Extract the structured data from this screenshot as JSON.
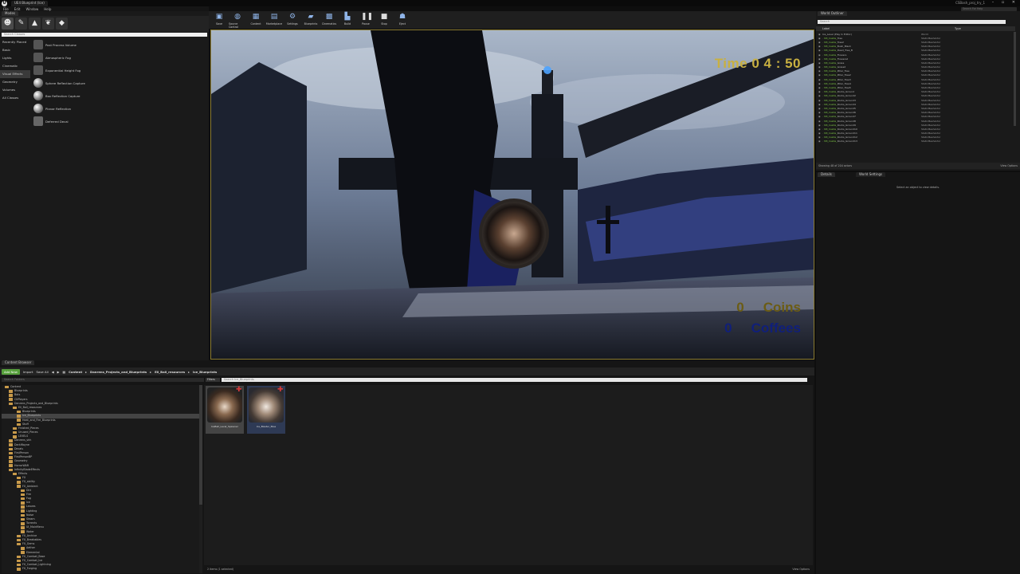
{
  "window": {
    "title": "UE4 Blueprint (Ice)",
    "project": "CSBash_proj_try_1"
  },
  "menu": [
    "File",
    "Edit",
    "Window",
    "Help"
  ],
  "modes": {
    "tab": "Modes",
    "search_placeholder": "Search Classes",
    "categories": [
      "Recently Placed",
      "Basic",
      "Lights",
      "Cinematic",
      "Visual Effects",
      "Geometry",
      "Volumes",
      "All Classes"
    ],
    "active_category": "Visual Effects",
    "items": [
      "Post Process Volume",
      "Atmospheric Fog",
      "Exponential Height Fog",
      "Sphere Reflection Capture",
      "Box Reflection Capture",
      "Planar Reflection",
      "Deferred Decal"
    ]
  },
  "toolbar": [
    "Save",
    "Source Control",
    "Content",
    "Marketplace",
    "Settings",
    "Blueprints",
    "Cinematics",
    "Build",
    "Pause",
    "Stop",
    "Eject"
  ],
  "hud": {
    "time_label": "Time",
    "time_value": "0 4 : 50",
    "coins_count": "0",
    "coins_label": "Coins",
    "coffees_count": "0",
    "coffees_label": "Coffees"
  },
  "outliner": {
    "tab": "World Outliner",
    "search_placeholder": "Search",
    "col_label": "Label",
    "col_type": "Type",
    "root": "Ice_Level (Play In Editor)",
    "root_type": "World",
    "prefix": "SM_Castle_",
    "rows": [
      "Tree",
      "Tree2",
      "Bush_Black",
      "Dead_Tree_B",
      "Flowers",
      "Flowers2",
      "Grass",
      "Grass2",
      "Pillar_Tree",
      "Pillar_Tree2",
      "Pillar_Tree3",
      "Pillar_Tree4",
      "Pillar_Tree5",
      "Rocks_Ground",
      "Rocks_Ground2",
      "Rocks_Ground3",
      "Rocks_Ground4",
      "Rocks_Ground5",
      "Rocks_Ground6",
      "Rocks_Ground7",
      "Rocks_Ground8",
      "Rocks_Ground9",
      "Rocks_Ground10",
      "Rocks_Ground11",
      "Rocks_Ground12",
      "Rocks_Ground13"
    ],
    "row_type": "StaticMeshActor",
    "status": "Showing 48 of 204 actors",
    "view_options": "View Options"
  },
  "details": {
    "tab1": "Details",
    "tab2": "World Settings",
    "empty": "Select an object to view details."
  },
  "content_browser": {
    "tab": "Content Browser",
    "add_new": "Add New",
    "import": "Import",
    "save_all": "Save All",
    "path": [
      "Content",
      "Danrens_Projects_and_Blueprints",
      "Eli_Ball_resources",
      "Ice_Blueprints"
    ],
    "search_folders": "Search Folders",
    "filters": "Filters",
    "search_assets": "Search Ice_Blueprints",
    "tree": [
      {
        "label": "Content",
        "depth": 0
      },
      {
        "label": "Blueprints",
        "depth": 1
      },
      {
        "label": "Bots",
        "depth": 1
      },
      {
        "label": "CitPlayers",
        "depth": 1
      },
      {
        "label": "Danrens_Projects_and_Blueprints",
        "depth": 1
      },
      {
        "label": "Eli_Ball_resources",
        "depth": 2
      },
      {
        "label": "Blueprints",
        "depth": 3
      },
      {
        "label": "Ice_Blueprints",
        "depth": 3,
        "selected": true
      },
      {
        "label": "Heat_and_Fire_Blueprints",
        "depth": 3
      },
      {
        "label": "Stuff",
        "depth": 3
      },
      {
        "label": "Finished_Pieces",
        "depth": 2
      },
      {
        "label": "Unused_Pieces",
        "depth": 2
      },
      {
        "label": "LEVELS",
        "depth": 2
      },
      {
        "label": "Danrens_shh",
        "depth": 1
      },
      {
        "label": "DarkWayne",
        "depth": 1
      },
      {
        "label": "Decals",
        "depth": 1
      },
      {
        "label": "FirstPerson",
        "depth": 1
      },
      {
        "label": "FirstPersonBP",
        "depth": 1
      },
      {
        "label": "Geometry",
        "depth": 1
      },
      {
        "label": "HorrorWAR",
        "depth": 1
      },
      {
        "label": "InfinityBladeEffects",
        "depth": 1
      },
      {
        "label": "Effects",
        "depth": 2
      },
      {
        "label": "FX",
        "depth": 3
      },
      {
        "label": "FX_ability",
        "depth": 3
      },
      {
        "label": "FX_Ambient",
        "depth": 3
      },
      {
        "label": "Dirt",
        "depth": 4
      },
      {
        "label": "Fire",
        "depth": 4
      },
      {
        "label": "Fog",
        "depth": 4
      },
      {
        "label": "Ice",
        "depth": 4
      },
      {
        "label": "Leaves",
        "depth": 4
      },
      {
        "label": "Lighting",
        "depth": 4
      },
      {
        "label": "Noise",
        "depth": 4
      },
      {
        "label": "Steam",
        "depth": 4
      },
      {
        "label": "Torrents",
        "depth": 4
      },
      {
        "label": "UI_MainMenu",
        "depth": 4
      },
      {
        "label": "Water",
        "depth": 4
      },
      {
        "label": "FX_Archive",
        "depth": 3
      },
      {
        "label": "FX_Breakables",
        "depth": 3
      },
      {
        "label": "FX_Gems",
        "depth": 3
      },
      {
        "label": "Aether",
        "depth": 4
      },
      {
        "label": "Elemental",
        "depth": 4
      },
      {
        "label": "FX_Combat_Base",
        "depth": 3
      },
      {
        "label": "FX_Combat_Ice",
        "depth": 3
      },
      {
        "label": "FX_Combat_Lightning",
        "depth": 3
      },
      {
        "label": "FX_Forging",
        "depth": 3
      }
    ],
    "assets": [
      "IceBall_Level_Spawner",
      "Ice_Blaster_Blue"
    ],
    "status": "2 items (1 selected)",
    "view_options": "View Options"
  }
}
